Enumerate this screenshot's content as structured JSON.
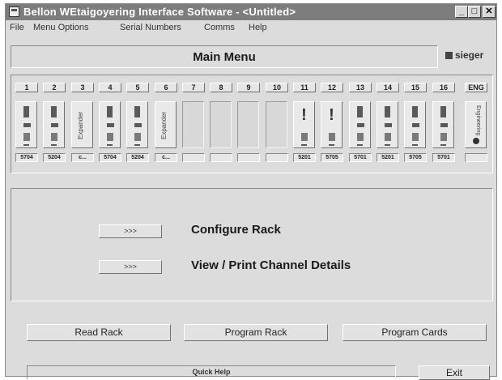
{
  "window": {
    "title": "Bellon WEtaigoyering Interface Software - <Untitled>",
    "controls": {
      "minimize": "_",
      "maximize": "□",
      "close": "✕"
    }
  },
  "menu": [
    "File",
    "Menu Options",
    "Serial Numbers",
    "Comms",
    "Help"
  ],
  "header": {
    "title": "Main Menu",
    "logo": "sieger"
  },
  "rack": {
    "slots": [
      {
        "num": "1",
        "type": "card",
        "code": "5704"
      },
      {
        "num": "2",
        "type": "card",
        "code": "5204"
      },
      {
        "num": "3",
        "type": "expander",
        "label": "Expander",
        "code": "c..."
      },
      {
        "num": "4",
        "type": "card",
        "code": "5704"
      },
      {
        "num": "5",
        "type": "card",
        "code": "5204"
      },
      {
        "num": "6",
        "type": "expander",
        "label": "Expander",
        "code": "c..."
      },
      {
        "num": "7",
        "type": "empty",
        "code": ""
      },
      {
        "num": "8",
        "type": "empty",
        "code": ""
      },
      {
        "num": "9",
        "type": "empty",
        "code": ""
      },
      {
        "num": "10",
        "type": "empty",
        "code": ""
      },
      {
        "num": "11",
        "type": "alert",
        "code": "5201"
      },
      {
        "num": "12",
        "type": "alert",
        "code": "5705"
      },
      {
        "num": "13",
        "type": "card",
        "code": "5701"
      },
      {
        "num": "14",
        "type": "card",
        "code": "5201"
      },
      {
        "num": "15",
        "type": "card",
        "code": "5705"
      },
      {
        "num": "16",
        "type": "card",
        "code": "5701"
      }
    ],
    "eng": {
      "num": "ENG",
      "label": "Engineering"
    }
  },
  "actions": {
    "configure": {
      "button": ">>>",
      "label": "Configure Rack"
    },
    "view_print": {
      "button": ">>>",
      "label": "View / Print Channel Details"
    }
  },
  "bottom": {
    "read": "Read Rack",
    "program_rack": "Program Rack",
    "program_cards": "Program Cards"
  },
  "status": {
    "quick_help": "Quick Help",
    "exit": "Exit"
  }
}
